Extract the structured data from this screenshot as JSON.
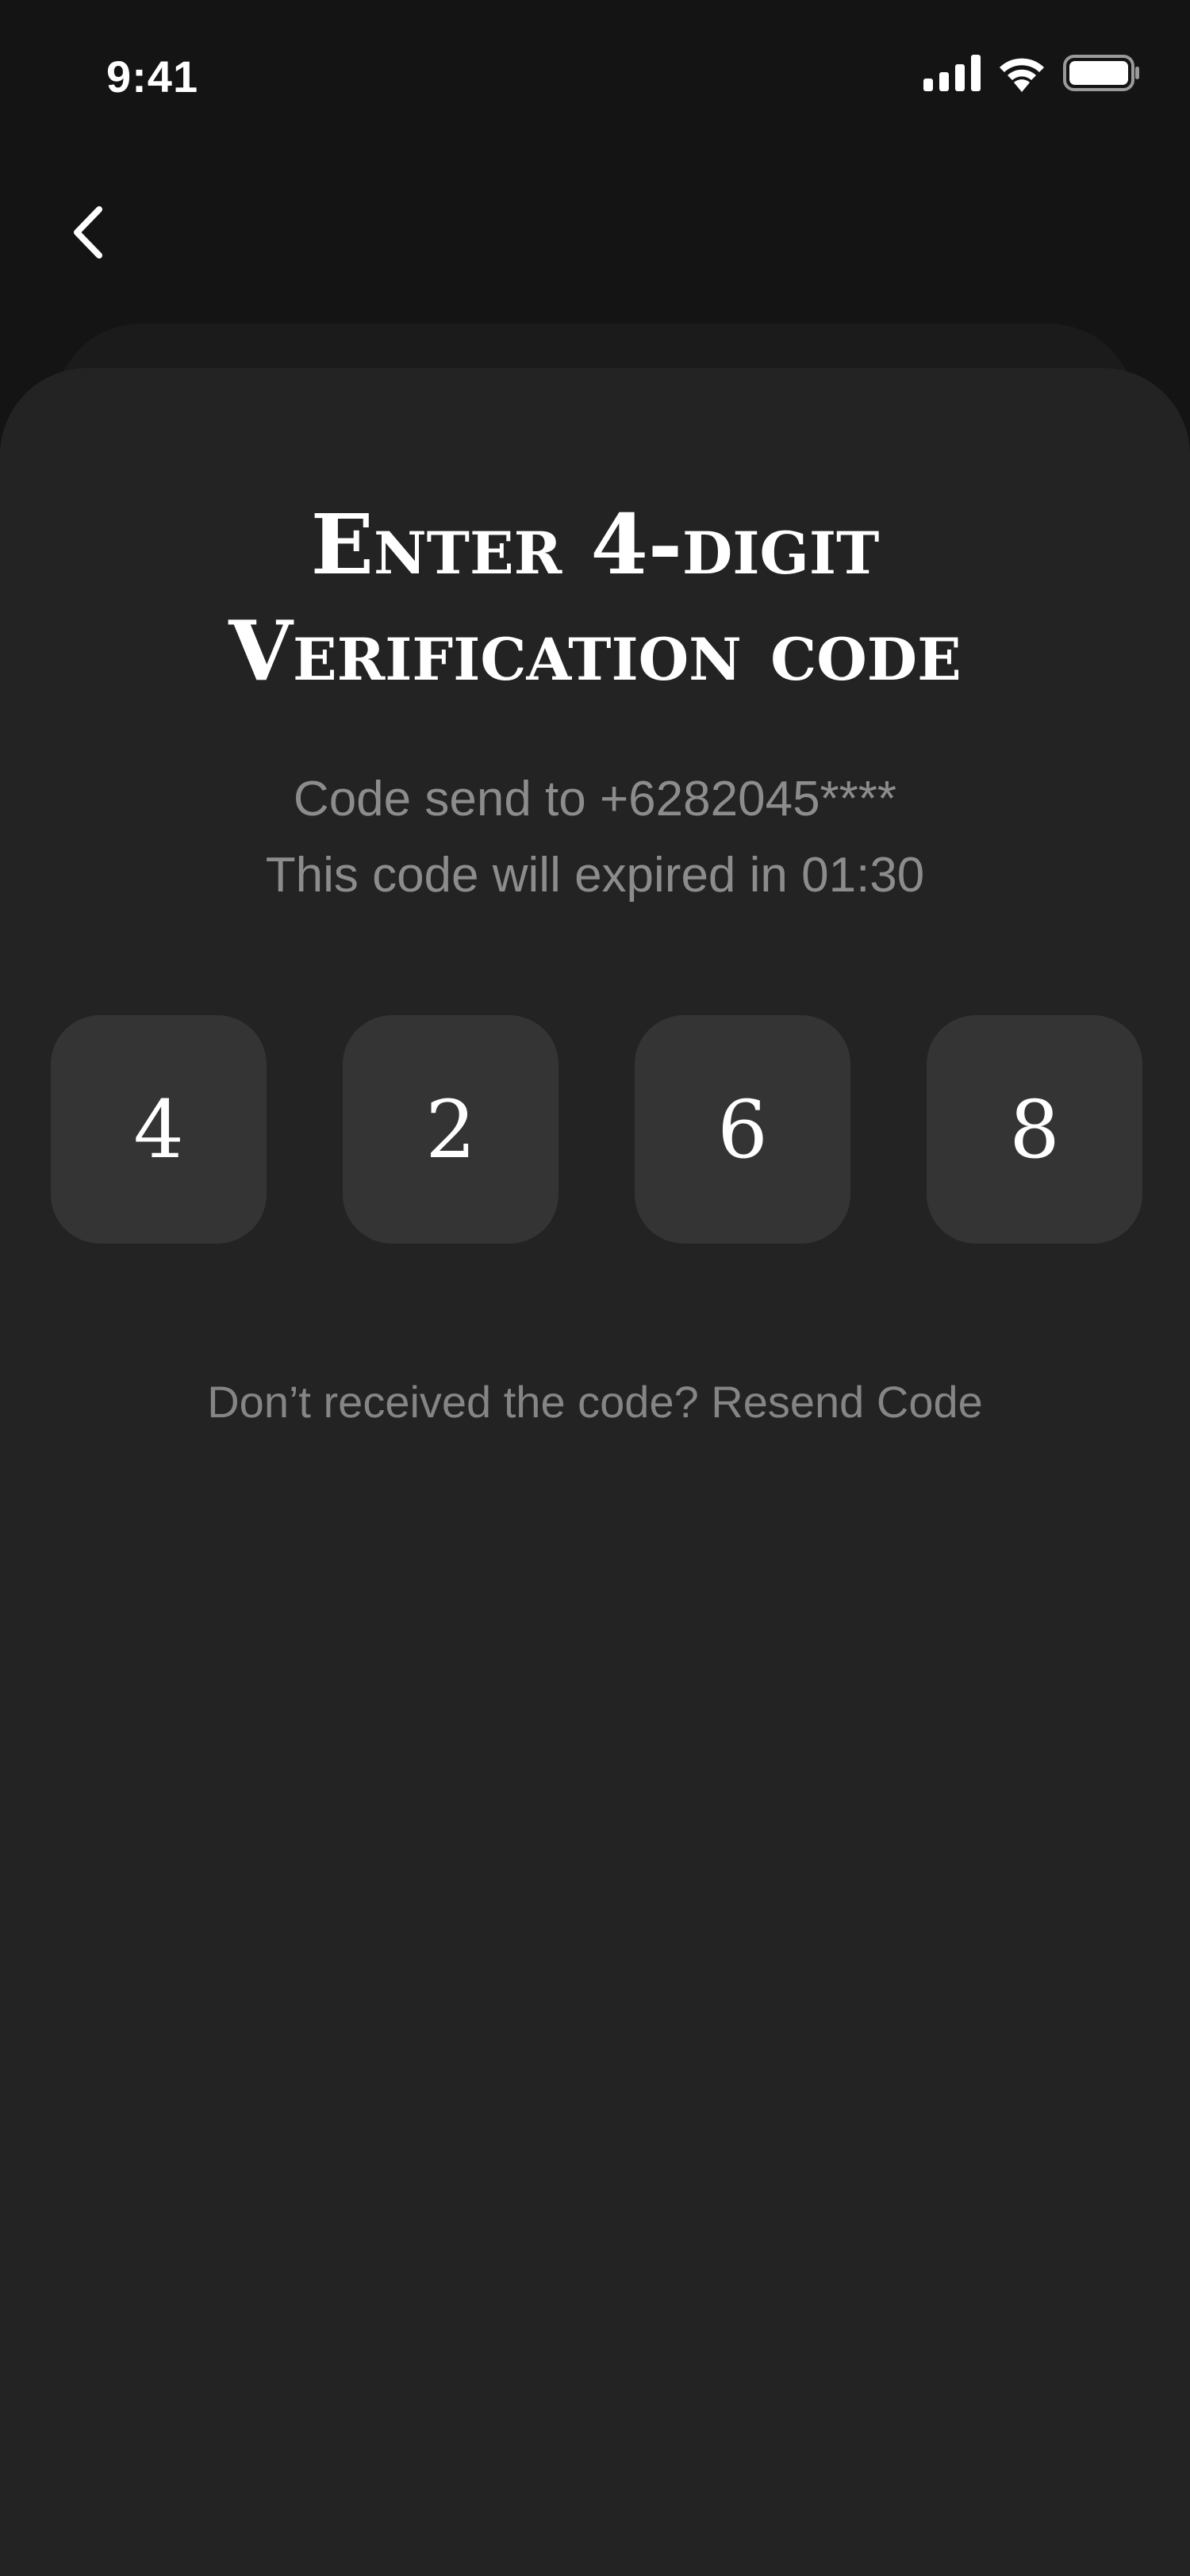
{
  "status_bar": {
    "time": "9:41",
    "icons": [
      "signal-icon",
      "wifi-icon",
      "battery-icon"
    ]
  },
  "navigation": {
    "back_icon": "chevron-left-icon"
  },
  "verification": {
    "title_line1": "Enter 4-digit",
    "title_line2": "Verification code",
    "code_sent_text": "Code send to +6282045****",
    "expiry_text": "This code will expired in 01:30",
    "digits": [
      "4",
      "2",
      "6",
      "8"
    ],
    "resend_prefix": "Don’t received the code?",
    "resend_link": "Resend Code"
  },
  "colors": {
    "background": "#141414",
    "card": "#232323",
    "code_box": "#343434",
    "muted_text": "#8c8c8c"
  }
}
